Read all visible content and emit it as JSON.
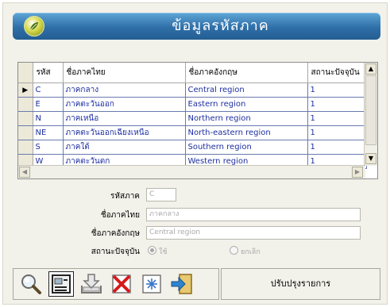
{
  "banner": {
    "title": "ข้อมูลรหัสภาค",
    "logo_icon": "leaf-logo-icon"
  },
  "grid": {
    "columns": [
      "รหัส",
      "ชื่อภาคไทย",
      "ชื่อภาคอังกฤษ",
      "สถานะปัจจุบัน"
    ],
    "current_row_marker": "▶",
    "rows": [
      {
        "code": "C",
        "thai": "ภาคกลาง",
        "english": "Central region",
        "status": "1"
      },
      {
        "code": "E",
        "thai": "ภาคตะวันออก",
        "english": "Eastern region",
        "status": "1"
      },
      {
        "code": "N",
        "thai": "ภาคเหนือ",
        "english": "Northern region",
        "status": "1"
      },
      {
        "code": "NE",
        "thai": "ภาคตะวันออกเฉียงเหนือ",
        "english": "North-eastern region",
        "status": "1"
      },
      {
        "code": "S",
        "thai": "ภาคใต้",
        "english": "Southern region",
        "status": "1"
      },
      {
        "code": "W",
        "thai": "ภาคตะวันตก",
        "english": "Western region",
        "status": "1"
      }
    ]
  },
  "form": {
    "code_label": "รหัสภาค",
    "code_value": "C",
    "thai_label": "ชื่อภาคไทย",
    "thai_value": "ภาคกลาง",
    "english_label": "ชื่อภาคอังกฤษ",
    "english_value": "Central region",
    "status_label": "สถานะปัจจุบัน",
    "status_options": [
      "ใช้",
      "ยกเลิก"
    ],
    "status_selected": "ใช้"
  },
  "toolbar": {
    "buttons": [
      "search-icon",
      "edit-record-icon",
      "save-download-icon",
      "delete-icon",
      "new-record-icon",
      "exit-icon"
    ]
  },
  "status_bar": {
    "text": "ปรับปรุงรายการ"
  },
  "colors": {
    "banner": "#2f6fa8",
    "grid_text": "#1e2fa0",
    "window_bg": "#f2f1ea"
  }
}
